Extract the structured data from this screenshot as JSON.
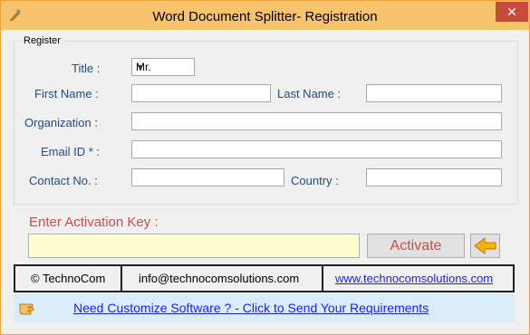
{
  "window": {
    "title": "Word Document Splitter- Registration",
    "close_symbol": "✕",
    "app_icon": "pen-icon"
  },
  "register_group": {
    "label": "Register",
    "title_label": "Title :",
    "title_selected": "Mr.",
    "first_name_label": "First Name :",
    "first_name_value": "",
    "last_name_label": "Last Name :",
    "last_name_value": "",
    "organization_label": "Organization :",
    "organization_value": "",
    "email_label": "Email ID * :",
    "email_value": "",
    "contact_label": "Contact No. :",
    "contact_value": "",
    "country_label": "Country :",
    "country_value": ""
  },
  "activation": {
    "label": "Enter Activation Key  :",
    "value": "",
    "button_label": "Activate",
    "arrow_icon": "left-arrow-icon"
  },
  "footer": {
    "company": "© TechnoCom",
    "email": "info@technocomsolutions.com",
    "website": "www.technocomsolutions.com"
  },
  "bottom": {
    "link_text": "Need Customize Software ? - Click to Send Your Requirements",
    "hand_icon": "pointing-hand-icon"
  },
  "colors": {
    "title_bar": "#f9c36d",
    "label_blue": "#1f4a8c",
    "activation_red": "#cc4c4c",
    "activation_input_bg": "#fdfdce",
    "bottom_bar_bg": "#d9eef8",
    "link_blue": "#1a1aff"
  }
}
